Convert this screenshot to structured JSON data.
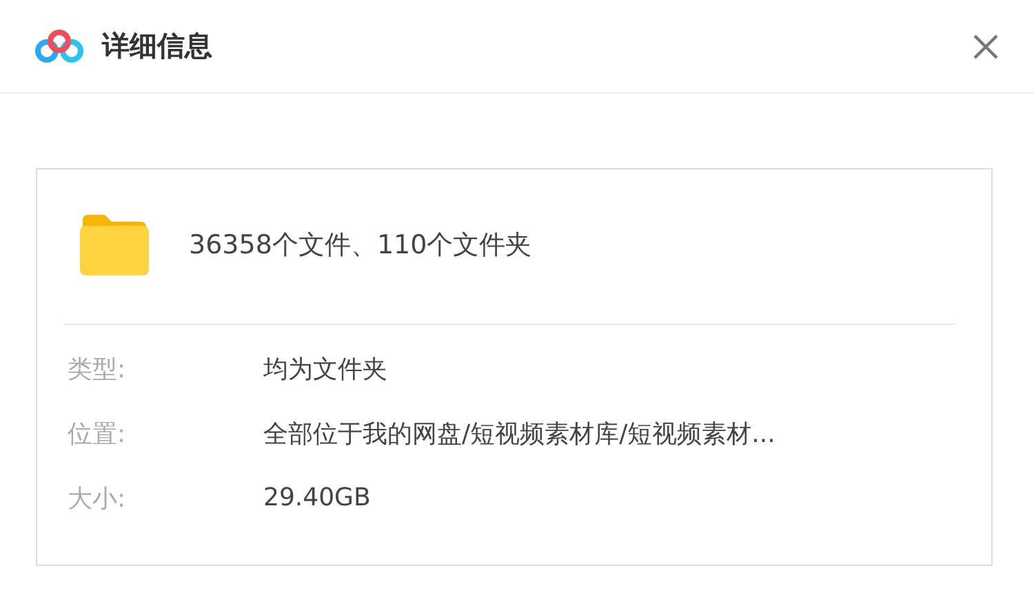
{
  "window": {
    "title": "详细信息"
  },
  "summary": "36358个文件、110个文件夹",
  "properties": [
    {
      "label": "类型:",
      "value": "均为文件夹"
    },
    {
      "label": "位置:",
      "value": "全部位于我的网盘/短视频素材库/短视频素材..."
    },
    {
      "label": "大小:",
      "value": "29.40GB"
    }
  ]
}
